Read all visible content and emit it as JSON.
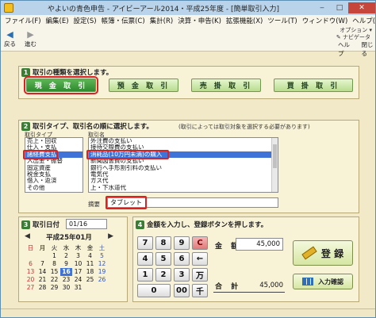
{
  "window": {
    "title": "やよいの青色申告 - アイビーアール2014・平成25年度 - [簡単取引入力]",
    "minimize": "‒",
    "maximize": "□",
    "close": "✕"
  },
  "menu": [
    "ファイル(F)",
    "編集(E)",
    "設定(S)",
    "帳簿・伝票(C)",
    "集計(R)",
    "決算・申告(K)",
    "拡張機能(X)",
    "ツール(T)",
    "ウィンドウ(W)",
    "ヘルプ(H)"
  ],
  "mdi_controls": [
    "‒",
    "▫",
    "✕"
  ],
  "toolbar": {
    "back": "戻る",
    "forward": "進む",
    "help": "ヘルプ",
    "close": "閉じる",
    "options_label": "オプション",
    "navigator_label": "ナビゲータ"
  },
  "section1": {
    "number": "1",
    "heading": "取引の種類を選択します。",
    "buttons": [
      "現 金 取 引",
      "預 金 取 引",
      "売 掛 取 引",
      "買 掛 取 引"
    ],
    "selected_index": 0
  },
  "section2": {
    "number": "2",
    "heading": "取引タイプ、取引名の順に選択します。",
    "note": "(取引によっては取引対象を選択する必要があります)",
    "type_label": "取引タイプ",
    "name_label": "取引名",
    "types": [
      "売上・回収",
      "仕入・支払",
      "諸経費支払",
      "入出金・振替",
      "固定資産",
      "税金支払",
      "借入・返済",
      "その他"
    ],
    "selected_type": 2,
    "names": [
      "外注費の支払い",
      "接待交際費の支払い",
      "消耗品(10万円未満)の購入",
      "新聞図書費の支払い",
      "銀行へ手形割引料の支払い",
      "電気代",
      "ガス代",
      "上・下水道代"
    ],
    "selected_name": 2,
    "memo_label": "摘要",
    "memo_value": "タブレット"
  },
  "section3": {
    "number": "3",
    "heading": "取引日付",
    "date_value": "01/16",
    "calendar_title": "平成25年01月",
    "prev_icon": "◀",
    "next_icon": "▶",
    "weekdays": [
      "日",
      "月",
      "火",
      "水",
      "木",
      "金",
      "土"
    ],
    "days": [
      "",
      "",
      "1",
      "2",
      "3",
      "4",
      "5",
      "6",
      "7",
      "8",
      "9",
      "10",
      "11",
      "12",
      "13",
      "14",
      "15",
      "16",
      "17",
      "18",
      "19",
      "20",
      "21",
      "22",
      "23",
      "24",
      "25",
      "26",
      "27",
      "28",
      "29",
      "30",
      "31",
      "",
      ""
    ],
    "today": "16"
  },
  "section4": {
    "number": "4",
    "heading": "金額を入力し、登録ボタンを押します。",
    "keys": [
      "7",
      "8",
      "9",
      "C",
      "4",
      "5",
      "6",
      "←",
      "1",
      "2",
      "3",
      "万",
      "0",
      "00",
      "千"
    ],
    "amount_label": "金 額",
    "amount_value": "45,000",
    "total_label": "合 計",
    "total_value": "45,000",
    "register_label": "登 録",
    "confirm_label": "入力確認"
  },
  "colors": {
    "accent_red": "#d92323",
    "selected_blue": "#3f73d8",
    "button_green": "#2e8a2e"
  }
}
